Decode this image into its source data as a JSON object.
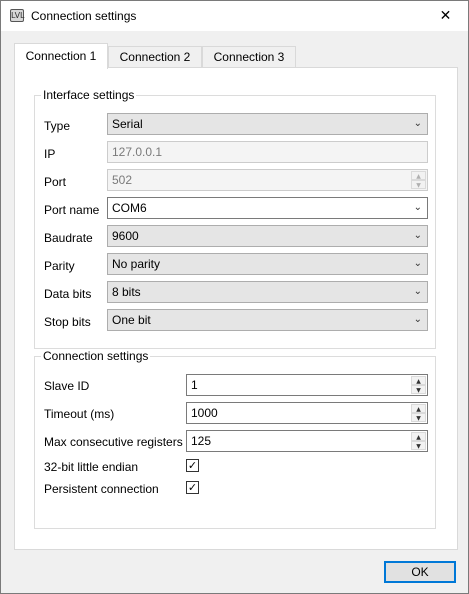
{
  "window": {
    "title": "Connection settings",
    "icon_text": "LVL",
    "close_glyph": "✕"
  },
  "tabs": [
    {
      "label": "Connection 1",
      "active": true
    },
    {
      "label": "Connection 2",
      "active": false
    },
    {
      "label": "Connection 3",
      "active": false
    }
  ],
  "interface": {
    "title": "Interface settings",
    "type": {
      "label": "Type",
      "value": "Serial"
    },
    "ip": {
      "label": "IP",
      "value": "127.0.0.1"
    },
    "port": {
      "label": "Port",
      "value": "502"
    },
    "port_name": {
      "label": "Port name",
      "value": "COM6"
    },
    "baudrate": {
      "label": "Baudrate",
      "value": "9600"
    },
    "parity": {
      "label": "Parity",
      "value": "No parity"
    },
    "data_bits": {
      "label": "Data bits",
      "value": "8 bits"
    },
    "stop_bits": {
      "label": "Stop bits",
      "value": "One bit"
    }
  },
  "connection": {
    "title": "Connection settings",
    "slave_id": {
      "label": "Slave ID",
      "value": "1"
    },
    "timeout": {
      "label": "Timeout (ms)",
      "value": "1000"
    },
    "max_registers": {
      "label": "Max consecutive registers",
      "value": "125"
    },
    "little_endian": {
      "label": "32-bit little endian",
      "checked": true,
      "glyph": "✓"
    },
    "persistent": {
      "label": "Persistent connection",
      "checked": true,
      "glyph": "✓"
    }
  },
  "buttons": {
    "ok": "OK"
  },
  "glyphs": {
    "chevron": "⌄",
    "spin_up": "▲",
    "spin_down": "▼"
  }
}
